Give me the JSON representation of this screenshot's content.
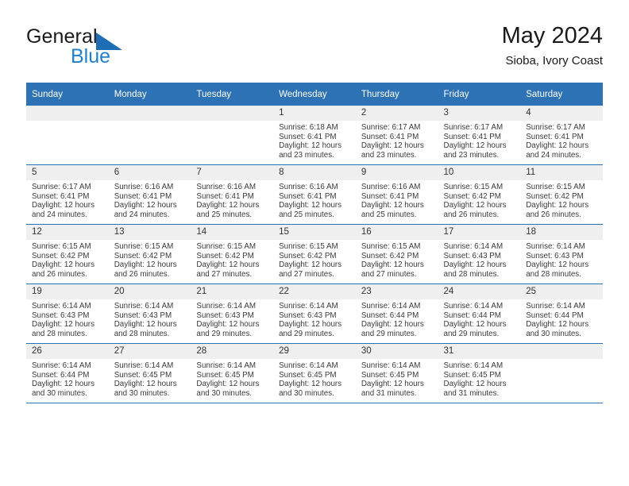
{
  "logo": {
    "word_top": "General",
    "word_bottom": "Blue",
    "triangle_icon": "triangle-icon",
    "accent_color": "#1f7fd0"
  },
  "header": {
    "title": "May 2024",
    "subtitle": "Sioba, Ivory Coast"
  },
  "theme": {
    "header_blue": "#2c72b4",
    "daynum_gray": "#efefef",
    "text": "#3a3a3a"
  },
  "calendar": {
    "weekday_headers": [
      "Sunday",
      "Monday",
      "Tuesday",
      "Wednesday",
      "Thursday",
      "Friday",
      "Saturday"
    ],
    "weeks": [
      [
        {
          "day": "",
          "lines": []
        },
        {
          "day": "",
          "lines": []
        },
        {
          "day": "",
          "lines": []
        },
        {
          "day": "1",
          "lines": [
            "Sunrise: 6:18 AM",
            "Sunset: 6:41 PM",
            "Daylight: 12 hours",
            "and 23 minutes."
          ]
        },
        {
          "day": "2",
          "lines": [
            "Sunrise: 6:17 AM",
            "Sunset: 6:41 PM",
            "Daylight: 12 hours",
            "and 23 minutes."
          ]
        },
        {
          "day": "3",
          "lines": [
            "Sunrise: 6:17 AM",
            "Sunset: 6:41 PM",
            "Daylight: 12 hours",
            "and 23 minutes."
          ]
        },
        {
          "day": "4",
          "lines": [
            "Sunrise: 6:17 AM",
            "Sunset: 6:41 PM",
            "Daylight: 12 hours",
            "and 24 minutes."
          ]
        }
      ],
      [
        {
          "day": "5",
          "lines": [
            "Sunrise: 6:17 AM",
            "Sunset: 6:41 PM",
            "Daylight: 12 hours",
            "and 24 minutes."
          ]
        },
        {
          "day": "6",
          "lines": [
            "Sunrise: 6:16 AM",
            "Sunset: 6:41 PM",
            "Daylight: 12 hours",
            "and 24 minutes."
          ]
        },
        {
          "day": "7",
          "lines": [
            "Sunrise: 6:16 AM",
            "Sunset: 6:41 PM",
            "Daylight: 12 hours",
            "and 25 minutes."
          ]
        },
        {
          "day": "8",
          "lines": [
            "Sunrise: 6:16 AM",
            "Sunset: 6:41 PM",
            "Daylight: 12 hours",
            "and 25 minutes."
          ]
        },
        {
          "day": "9",
          "lines": [
            "Sunrise: 6:16 AM",
            "Sunset: 6:41 PM",
            "Daylight: 12 hours",
            "and 25 minutes."
          ]
        },
        {
          "day": "10",
          "lines": [
            "Sunrise: 6:15 AM",
            "Sunset: 6:42 PM",
            "Daylight: 12 hours",
            "and 26 minutes."
          ]
        },
        {
          "day": "11",
          "lines": [
            "Sunrise: 6:15 AM",
            "Sunset: 6:42 PM",
            "Daylight: 12 hours",
            "and 26 minutes."
          ]
        }
      ],
      [
        {
          "day": "12",
          "lines": [
            "Sunrise: 6:15 AM",
            "Sunset: 6:42 PM",
            "Daylight: 12 hours",
            "and 26 minutes."
          ]
        },
        {
          "day": "13",
          "lines": [
            "Sunrise: 6:15 AM",
            "Sunset: 6:42 PM",
            "Daylight: 12 hours",
            "and 26 minutes."
          ]
        },
        {
          "day": "14",
          "lines": [
            "Sunrise: 6:15 AM",
            "Sunset: 6:42 PM",
            "Daylight: 12 hours",
            "and 27 minutes."
          ]
        },
        {
          "day": "15",
          "lines": [
            "Sunrise: 6:15 AM",
            "Sunset: 6:42 PM",
            "Daylight: 12 hours",
            "and 27 minutes."
          ]
        },
        {
          "day": "16",
          "lines": [
            "Sunrise: 6:15 AM",
            "Sunset: 6:42 PM",
            "Daylight: 12 hours",
            "and 27 minutes."
          ]
        },
        {
          "day": "17",
          "lines": [
            "Sunrise: 6:14 AM",
            "Sunset: 6:43 PM",
            "Daylight: 12 hours",
            "and 28 minutes."
          ]
        },
        {
          "day": "18",
          "lines": [
            "Sunrise: 6:14 AM",
            "Sunset: 6:43 PM",
            "Daylight: 12 hours",
            "and 28 minutes."
          ]
        }
      ],
      [
        {
          "day": "19",
          "lines": [
            "Sunrise: 6:14 AM",
            "Sunset: 6:43 PM",
            "Daylight: 12 hours",
            "and 28 minutes."
          ]
        },
        {
          "day": "20",
          "lines": [
            "Sunrise: 6:14 AM",
            "Sunset: 6:43 PM",
            "Daylight: 12 hours",
            "and 28 minutes."
          ]
        },
        {
          "day": "21",
          "lines": [
            "Sunrise: 6:14 AM",
            "Sunset: 6:43 PM",
            "Daylight: 12 hours",
            "and 29 minutes."
          ]
        },
        {
          "day": "22",
          "lines": [
            "Sunrise: 6:14 AM",
            "Sunset: 6:43 PM",
            "Daylight: 12 hours",
            "and 29 minutes."
          ]
        },
        {
          "day": "23",
          "lines": [
            "Sunrise: 6:14 AM",
            "Sunset: 6:44 PM",
            "Daylight: 12 hours",
            "and 29 minutes."
          ]
        },
        {
          "day": "24",
          "lines": [
            "Sunrise: 6:14 AM",
            "Sunset: 6:44 PM",
            "Daylight: 12 hours",
            "and 29 minutes."
          ]
        },
        {
          "day": "25",
          "lines": [
            "Sunrise: 6:14 AM",
            "Sunset: 6:44 PM",
            "Daylight: 12 hours",
            "and 30 minutes."
          ]
        }
      ],
      [
        {
          "day": "26",
          "lines": [
            "Sunrise: 6:14 AM",
            "Sunset: 6:44 PM",
            "Daylight: 12 hours",
            "and 30 minutes."
          ]
        },
        {
          "day": "27",
          "lines": [
            "Sunrise: 6:14 AM",
            "Sunset: 6:45 PM",
            "Daylight: 12 hours",
            "and 30 minutes."
          ]
        },
        {
          "day": "28",
          "lines": [
            "Sunrise: 6:14 AM",
            "Sunset: 6:45 PM",
            "Daylight: 12 hours",
            "and 30 minutes."
          ]
        },
        {
          "day": "29",
          "lines": [
            "Sunrise: 6:14 AM",
            "Sunset: 6:45 PM",
            "Daylight: 12 hours",
            "and 30 minutes."
          ]
        },
        {
          "day": "30",
          "lines": [
            "Sunrise: 6:14 AM",
            "Sunset: 6:45 PM",
            "Daylight: 12 hours",
            "and 31 minutes."
          ]
        },
        {
          "day": "31",
          "lines": [
            "Sunrise: 6:14 AM",
            "Sunset: 6:45 PM",
            "Daylight: 12 hours",
            "and 31 minutes."
          ]
        },
        {
          "day": "",
          "lines": []
        }
      ]
    ]
  }
}
